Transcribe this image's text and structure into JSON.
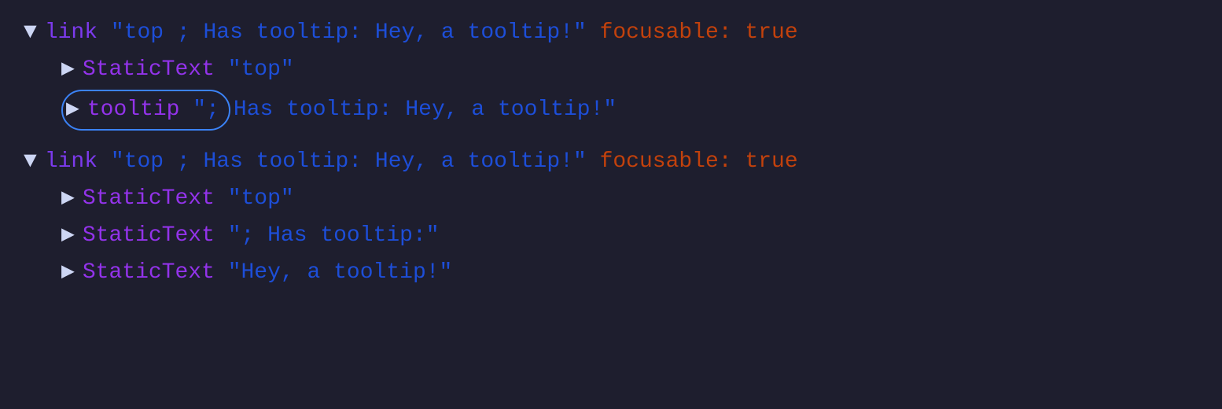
{
  "tree": {
    "block1": {
      "row1": {
        "arrow": "▼",
        "keyword": "link",
        "string": "\"top ; Has tooltip: Hey, a tooltip!\"",
        "attr": "focusable:",
        "attrVal": "true"
      },
      "row2": {
        "arrow": "▶",
        "keyword": "StaticText",
        "string": "\"top\""
      },
      "row3": {
        "arrow": "▶",
        "keyword": "tooltip",
        "string": "\";",
        "rest": "Has tooltip: Hey, a tooltip!\""
      }
    },
    "block2": {
      "row1": {
        "arrow": "▼",
        "keyword": "link",
        "string": "\"top ; Has tooltip: Hey, a tooltip!\"",
        "attr": "focusable:",
        "attrVal": "true"
      },
      "row2": {
        "arrow": "▶",
        "keyword": "StaticText",
        "string": "\"top\""
      },
      "row3": {
        "arrow": "▶",
        "keyword": "StaticText",
        "string": "\"; Has tooltip:\""
      },
      "row4": {
        "arrow": "▶",
        "keyword": "StaticText",
        "string": "\"Hey, a tooltip!\""
      }
    }
  }
}
